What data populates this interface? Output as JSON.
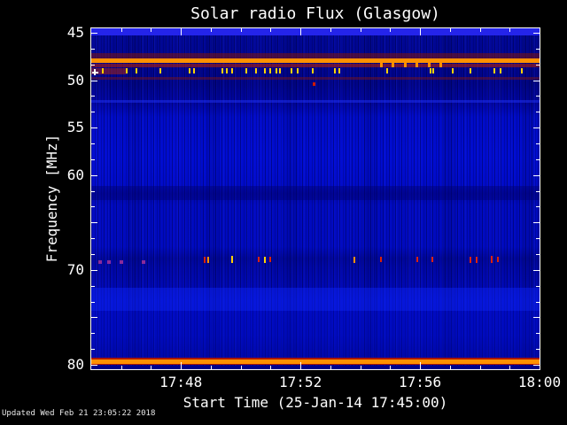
{
  "footer": {
    "updated_text": "Updated Wed Feb 21 23:05:22 2018"
  },
  "chart_data": {
    "type": "heatmap",
    "title": "Solar radio Flux (Glasgow)",
    "xlabel": "Start Time (25-Jan-14 17:45:00)",
    "ylabel": "Frequency [MHz]",
    "x_start": "17:45",
    "x_end": "18:00",
    "x_span_min": 15,
    "x_tick_labels": [
      "17:48",
      "17:52",
      "17:56",
      "18:00"
    ],
    "x_tick_minutes": [
      3,
      7,
      11,
      15
    ],
    "x_minor_interval_min": 1,
    "y_range_mhz": [
      44.53,
      80.47
    ],
    "y_axis_direction": "increasing-downward",
    "y_labeled_ticks": [
      {
        "label": "45",
        "f": 45
      },
      {
        "label": "50",
        "f": 50
      },
      {
        "label": "55",
        "f": 55
      },
      {
        "label": "60",
        "f": 60
      },
      {
        "label": "70",
        "f": 70
      },
      {
        "label": "80",
        "f": 80
      }
    ],
    "y_major_ticks_mhz": [
      45,
      50,
      55,
      60,
      65,
      70,
      75,
      80
    ],
    "grid": false,
    "legend": false,
    "palette": {
      "background": "#000000",
      "text": "#ffffff",
      "border": "#ffffff",
      "base_blue": "#000ac0",
      "bright_blue": "#2424ea",
      "dark_blue": "#000088",
      "orange": "#ff9100",
      "yellow": "#ffd200",
      "red": "#dd2200",
      "dark_red": "#8a1500",
      "purple": "#8a2b9a"
    },
    "bands": [
      {
        "name": "top-edge-bright-band",
        "f1": 44.53,
        "f2": 45.32,
        "color": "#2424ea",
        "texture": "speckle"
      },
      {
        "name": "red-mottle-47.4",
        "f1": 47.18,
        "f2": 47.66,
        "color": "rgba(140,20,0,0.50)",
        "texture": "mottle"
      },
      {
        "name": "orange-rfi-band-48",
        "f1": 47.74,
        "f2": 48.16,
        "color": "#ff9100",
        "texture": "yellow-dashes"
      },
      {
        "name": "red-mottle-48.5",
        "f1": 48.25,
        "f2": 48.66,
        "color": "rgba(190,30,0,0.55)",
        "texture": "mottle"
      },
      {
        "name": "left-red-patch-49",
        "f1": 48.7,
        "f2": 49.4,
        "t1": 0.0,
        "t2": 1.15,
        "color": "rgba(200,40,0,0.45)",
        "texture": "mottle"
      },
      {
        "name": "faint-red-line-49.8",
        "f1": 49.62,
        "f2": 49.9,
        "color": "rgba(150,25,0,0.40)",
        "texture": "mottle"
      },
      {
        "name": "bright-blue-line-52.2",
        "f1": 52.05,
        "f2": 52.38,
        "color": "rgba(35,55,255,0.45)"
      },
      {
        "name": "dark-band-61.8",
        "f1": 61.15,
        "f2": 62.6,
        "color": "rgba(0,0,110,0.40)"
      },
      {
        "name": "bright-textured-72-74",
        "f1": 71.9,
        "f2": 74.3,
        "color": "rgba(12,34,240,0.50)",
        "texture": "streaks-strong"
      },
      {
        "name": "wavy-textured-74-79",
        "f1": 74.3,
        "f2": 79.28,
        "color": "rgba(0,12,195,0.35)",
        "texture": "wavy"
      },
      {
        "name": "red-edge-top-80band",
        "f1": 79.22,
        "f2": 79.4,
        "color": "#aa1800"
      },
      {
        "name": "orange-rfi-band-80",
        "f1": 79.4,
        "f2": 79.9,
        "color": "#ff9100"
      },
      {
        "name": "red-edge-bottom-80band",
        "f1": 79.9,
        "f2": 80.05,
        "color": "#aa1800"
      },
      {
        "name": "bottom-dark-blue",
        "f1": 80.05,
        "f2": 80.47,
        "color": "#000088"
      }
    ],
    "burst_rows": [
      {
        "name": "yellow-bursts-49mhz",
        "f": 49.05,
        "color": "#ffd200",
        "w": 2,
        "h": 6,
        "t_min": [
          0.4,
          1.2,
          1.5,
          2.3,
          3.3,
          3.45,
          4.4,
          4.55,
          4.7,
          5.2,
          5.5,
          5.8,
          6.0,
          6.2,
          6.3,
          6.7,
          6.9,
          7.4,
          8.15,
          8.3,
          9.9,
          11.35,
          11.45,
          12.1,
          12.7,
          13.5,
          13.7,
          14.4
        ]
      },
      {
        "name": "orange-bursts-48.5mhz",
        "f": 48.45,
        "color": "#ff9100",
        "w": 3,
        "h": 5,
        "t_min": [
          9.7,
          10.1,
          10.5,
          10.9,
          11.3,
          11.7
        ]
      },
      {
        "name": "purple-dots-69mhz",
        "f": 69.2,
        "color": "#8a2b9a",
        "w": 4,
        "h": 4,
        "t_min": [
          0.3,
          0.6,
          1.0,
          1.75
        ]
      }
    ],
    "point_marks": [
      {
        "name": "burst-69mhz",
        "t": 3.8,
        "f": 68.9,
        "color": "#dd2200",
        "w": 2,
        "h": 7
      },
      {
        "name": "burst-69mhz",
        "t": 3.9,
        "f": 68.9,
        "color": "#ff9100",
        "w": 2,
        "h": 7
      },
      {
        "name": "burst-69mhz",
        "t": 4.7,
        "f": 68.9,
        "color": "#ffd200",
        "w": 2,
        "h": 8
      },
      {
        "name": "burst-69mhz",
        "t": 5.6,
        "f": 68.9,
        "color": "#dd2200",
        "w": 2,
        "h": 6
      },
      {
        "name": "burst-69mhz",
        "t": 5.8,
        "f": 68.9,
        "color": "#ffd200",
        "w": 2,
        "h": 7
      },
      {
        "name": "burst-69mhz",
        "t": 6.0,
        "f": 68.9,
        "color": "#dd2200",
        "w": 2,
        "h": 6
      },
      {
        "name": "burst-69mhz",
        "t": 8.8,
        "f": 68.9,
        "color": "#ff9100",
        "w": 2,
        "h": 7
      },
      {
        "name": "burst-69mhz",
        "t": 9.7,
        "f": 68.9,
        "color": "#dd2200",
        "w": 2,
        "h": 6
      },
      {
        "name": "burst-69mhz",
        "t": 10.9,
        "f": 68.9,
        "color": "#dd2200",
        "w": 2,
        "h": 6
      },
      {
        "name": "burst-69mhz",
        "t": 11.4,
        "f": 68.9,
        "color": "#dd2200",
        "w": 2,
        "h": 6
      },
      {
        "name": "burst-69mhz",
        "t": 12.7,
        "f": 68.9,
        "color": "#dd2200",
        "w": 2,
        "h": 7
      },
      {
        "name": "burst-69mhz",
        "t": 12.9,
        "f": 68.9,
        "color": "#dd2200",
        "w": 2,
        "h": 7
      },
      {
        "name": "burst-69mhz",
        "t": 13.4,
        "f": 68.9,
        "color": "#dd2200",
        "w": 2,
        "h": 8
      },
      {
        "name": "burst-69mhz",
        "t": 13.6,
        "f": 68.9,
        "color": "#dd2200",
        "w": 2,
        "h": 6
      },
      {
        "name": "red-spot-50.4mhz",
        "t": 7.47,
        "f": 50.4,
        "color": "#cc1800",
        "w": 3,
        "h": 4
      }
    ],
    "artifact_cross": {
      "t": 0.12,
      "f": 49.2
    }
  }
}
